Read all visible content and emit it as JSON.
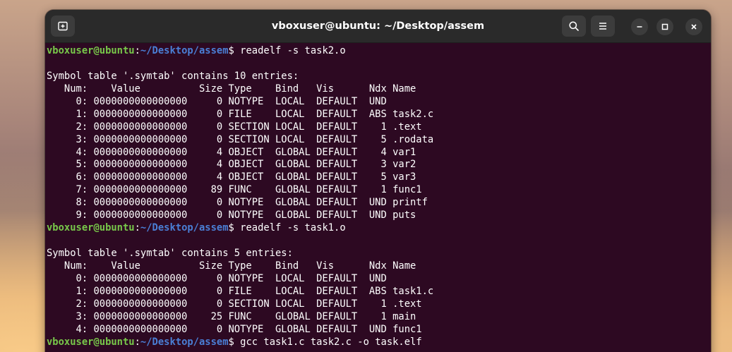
{
  "window": {
    "title": "vboxuser@ubuntu: ~/Desktop/assem"
  },
  "titlebar": {
    "new_tab_icon": "new-tab-icon",
    "search_icon": "search-icon",
    "menu_icon": "hamburger-menu-icon",
    "minimize_icon": "minimize-icon",
    "maximize_icon": "maximize-icon",
    "close_icon": "close-icon"
  },
  "colors": {
    "terminal_bg": "#2d0922",
    "prompt_user": "#78c84a",
    "prompt_path": "#4a7fd6",
    "text": "#ffffff"
  },
  "terminal": {
    "prompt": {
      "user": "vboxuser@ubuntu",
      "sep": ":",
      "path": "~/Desktop/assem",
      "dollar": "$ "
    },
    "lines": [
      {
        "type": "prompt",
        "cmd": "readelf -s task2.o"
      },
      {
        "type": "output",
        "text": ""
      },
      {
        "type": "output",
        "text": "Symbol table '.symtab' contains 10 entries:"
      },
      {
        "type": "output",
        "text": "   Num:    Value          Size Type    Bind   Vis      Ndx Name"
      },
      {
        "type": "output",
        "text": "     0: 0000000000000000     0 NOTYPE  LOCAL  DEFAULT  UND "
      },
      {
        "type": "output",
        "text": "     1: 0000000000000000     0 FILE    LOCAL  DEFAULT  ABS task2.c"
      },
      {
        "type": "output",
        "text": "     2: 0000000000000000     0 SECTION LOCAL  DEFAULT    1 .text"
      },
      {
        "type": "output",
        "text": "     3: 0000000000000000     0 SECTION LOCAL  DEFAULT    5 .rodata"
      },
      {
        "type": "output",
        "text": "     4: 0000000000000000     4 OBJECT  GLOBAL DEFAULT    4 var1"
      },
      {
        "type": "output",
        "text": "     5: 0000000000000000     4 OBJECT  GLOBAL DEFAULT    3 var2"
      },
      {
        "type": "output",
        "text": "     6: 0000000000000000     4 OBJECT  GLOBAL DEFAULT    5 var3"
      },
      {
        "type": "output",
        "text": "     7: 0000000000000000    89 FUNC    GLOBAL DEFAULT    1 func1"
      },
      {
        "type": "output",
        "text": "     8: 0000000000000000     0 NOTYPE  GLOBAL DEFAULT  UND printf"
      },
      {
        "type": "output",
        "text": "     9: 0000000000000000     0 NOTYPE  GLOBAL DEFAULT  UND puts"
      },
      {
        "type": "prompt",
        "cmd": "readelf -s task1.o"
      },
      {
        "type": "output",
        "text": ""
      },
      {
        "type": "output",
        "text": "Symbol table '.symtab' contains 5 entries:"
      },
      {
        "type": "output",
        "text": "   Num:    Value          Size Type    Bind   Vis      Ndx Name"
      },
      {
        "type": "output",
        "text": "     0: 0000000000000000     0 NOTYPE  LOCAL  DEFAULT  UND "
      },
      {
        "type": "output",
        "text": "     1: 0000000000000000     0 FILE    LOCAL  DEFAULT  ABS task1.c"
      },
      {
        "type": "output",
        "text": "     2: 0000000000000000     0 SECTION LOCAL  DEFAULT    1 .text"
      },
      {
        "type": "output",
        "text": "     3: 0000000000000000    25 FUNC    GLOBAL DEFAULT    1 main"
      },
      {
        "type": "output",
        "text": "     4: 0000000000000000     0 NOTYPE  GLOBAL DEFAULT  UND func1"
      },
      {
        "type": "prompt",
        "cmd": "gcc task1.c task2.c -o task.elf"
      }
    ]
  }
}
